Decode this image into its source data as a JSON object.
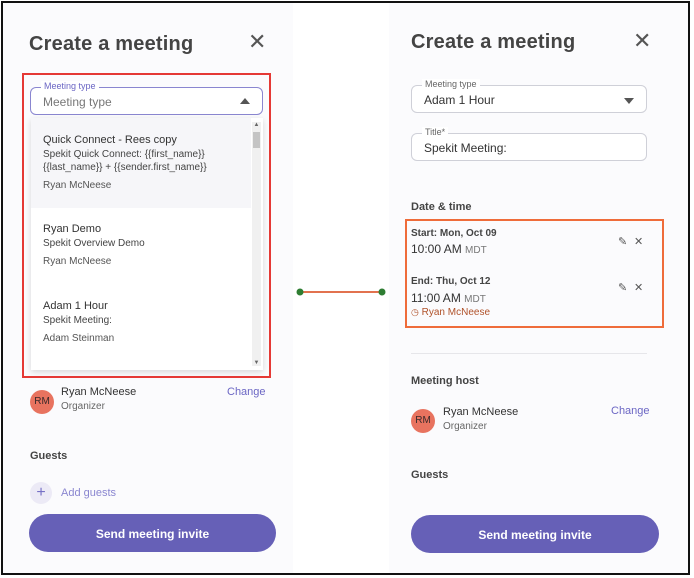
{
  "left": {
    "title": "Create a meeting",
    "close_icon": "close-icon",
    "meeting_type": {
      "label": "Meeting type",
      "placeholder": "Meeting type"
    },
    "dropdown_items": [
      {
        "title": "Quick Connect - Rees copy",
        "subtitle_1": "Spekit Quick Connect: {{first_name}}",
        "subtitle_2": "{{last_name}} + {{sender.first_name}}",
        "owner": "Ryan McNeese"
      },
      {
        "title": "Ryan Demo",
        "subtitle_1": "Spekit Overview Demo",
        "owner": "Ryan McNeese"
      },
      {
        "title": "Adam 1 Hour",
        "subtitle_1": "Spekit Meeting:",
        "owner": "Adam Steinman"
      }
    ],
    "host": {
      "initials": "RM",
      "name": "Ryan McNeese",
      "role": "Organizer",
      "change_label": "Change"
    },
    "guests_heading": "Guests",
    "add_guests_label": "Add guests",
    "send_label": "Send meeting invite"
  },
  "right": {
    "title": "Create a meeting",
    "meeting_type": {
      "label": "Meeting type",
      "value": "Adam 1 Hour"
    },
    "title_field": {
      "label": "Title*",
      "value": "Spekit Meeting:"
    },
    "date_time_heading": "Date & time",
    "start": {
      "label": "Start: Mon, Oct 09",
      "time": "10:00 AM",
      "tz": "MDT"
    },
    "end": {
      "label": "End: Thu, Oct 12",
      "time": "11:00 AM",
      "tz": "MDT"
    },
    "owner_tag": "Ryan McNeese",
    "meeting_host_heading": "Meeting host",
    "host": {
      "initials": "RM",
      "name": "Ryan McNeese",
      "role": "Organizer",
      "change_label": "Change"
    },
    "guests_heading": "Guests",
    "send_label": "Send meeting invite"
  },
  "colors": {
    "accent": "#6660b7",
    "highlight_red": "#e53935",
    "highlight_orange": "#ef6c3a",
    "connector_dot": "#2e7d32",
    "avatar": "#e8735f"
  }
}
